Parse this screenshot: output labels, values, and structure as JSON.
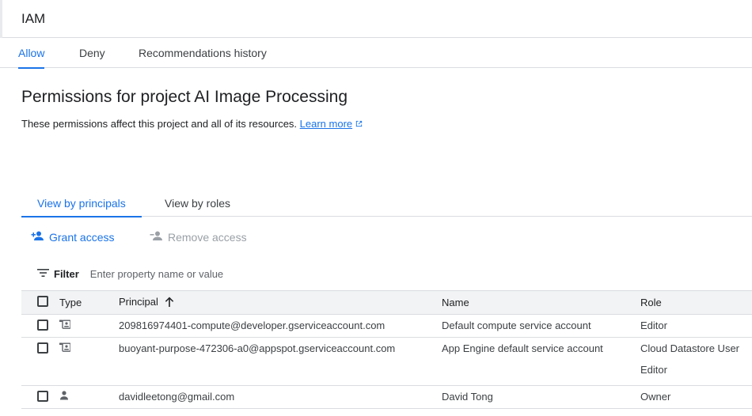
{
  "header": {
    "title": "IAM"
  },
  "top_tabs": [
    {
      "label": "Allow",
      "active": true
    },
    {
      "label": "Deny",
      "active": false
    },
    {
      "label": "Recommendations history",
      "active": false
    }
  ],
  "page": {
    "title": "Permissions for project AI Image Processing",
    "subtitle": "These permissions affect this project and all of its resources.",
    "learn_more": "Learn more"
  },
  "view_tabs": [
    {
      "label": "View by principals",
      "active": true
    },
    {
      "label": "View by roles",
      "active": false
    }
  ],
  "actions": {
    "grant": "Grant access",
    "remove": "Remove access"
  },
  "filter": {
    "label": "Filter",
    "placeholder": "Enter property name or value"
  },
  "table": {
    "headers": {
      "type": "Type",
      "principal": "Principal",
      "name": "Name",
      "role": "Role"
    },
    "sort": "ascending",
    "rows": [
      {
        "type_icon": "service-account-icon",
        "principal": "209816974401-compute@developer.gserviceaccount.com",
        "name": "Default compute service account",
        "roles": [
          "Editor"
        ]
      },
      {
        "type_icon": "service-account-icon",
        "principal": "buoyant-purpose-472306-a0@appspot.gserviceaccount.com",
        "name": "App Engine default service account",
        "roles": [
          "Cloud Datastore User",
          "Editor"
        ]
      },
      {
        "type_icon": "person-icon",
        "principal": "davidleetong@gmail.com",
        "name": "David Tong",
        "roles": [
          "Owner"
        ]
      }
    ]
  },
  "colors": {
    "accent": "#1a73e8",
    "disabled": "#9aa0a6",
    "header_bg": "#f1f3f4"
  }
}
